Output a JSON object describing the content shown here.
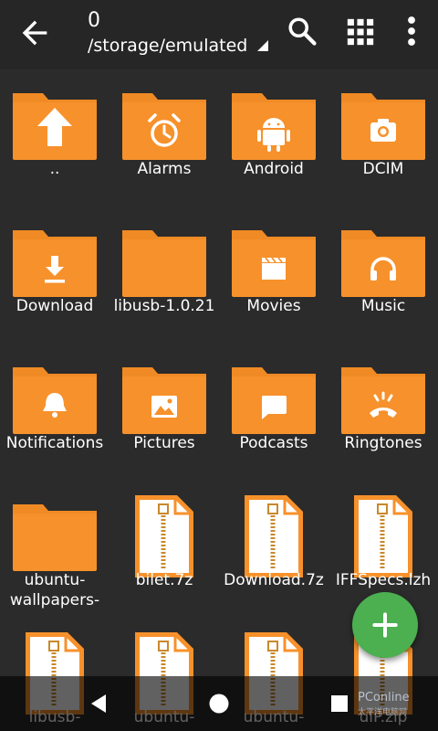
{
  "header": {
    "count": "0",
    "path": "/storage/emulated"
  },
  "colors": {
    "folder": "#f7912b",
    "folder_tab": "#f08a24",
    "folder_glyph": "#ffffff",
    "archive_border": "#f7912b",
    "archive_paper": "#ffffff",
    "zipper": "#c9892a",
    "fab": "#4caf50",
    "background": "#2b2b2b"
  },
  "files": [
    {
      "label": "..",
      "icon": "up-arrow-icon",
      "kind": "folder"
    },
    {
      "label": "Alarms",
      "icon": "alarm-clock-icon",
      "kind": "folder"
    },
    {
      "label": "Android",
      "icon": "android-robot-icon",
      "kind": "folder"
    },
    {
      "label": "DCIM",
      "icon": "camera-icon",
      "kind": "folder"
    },
    {
      "label": "Download",
      "icon": "download-icon",
      "kind": "folder"
    },
    {
      "label": "libusb-1.0.21",
      "icon": "folder-icon",
      "kind": "folder"
    },
    {
      "label": "Movies",
      "icon": "clapperboard-icon",
      "kind": "folder"
    },
    {
      "label": "Music",
      "icon": "headphones-icon",
      "kind": "folder"
    },
    {
      "label": "Notifications",
      "icon": "bell-icon",
      "kind": "folder"
    },
    {
      "label": "Pictures",
      "icon": "image-icon",
      "kind": "folder"
    },
    {
      "label": "Podcasts",
      "icon": "chat-bubble-icon",
      "kind": "folder"
    },
    {
      "label": "Ringtones",
      "icon": "ringing-phone-icon",
      "kind": "folder"
    },
    {
      "label": "ubuntu-\nwallpapers-",
      "icon": "folder-icon",
      "kind": "folder"
    },
    {
      "label": "bilet.7z",
      "icon": "archive-icon",
      "kind": "archive"
    },
    {
      "label": "Download.7z",
      "icon": "archive-icon",
      "kind": "archive"
    },
    {
      "label": "IFFSpecs.lzh",
      "icon": "archive-icon",
      "kind": "archive"
    },
    {
      "label": "libusb-",
      "icon": "archive-icon",
      "kind": "archive"
    },
    {
      "label": "ubuntu-",
      "icon": "archive-icon",
      "kind": "archive"
    },
    {
      "label": "ubuntu-",
      "icon": "archive-icon",
      "kind": "archive"
    },
    {
      "label": "ulP.zip",
      "icon": "archive-icon",
      "kind": "archive"
    }
  ],
  "watermark": {
    "name": "PConline",
    "sub": "太平洋电脑网"
  }
}
